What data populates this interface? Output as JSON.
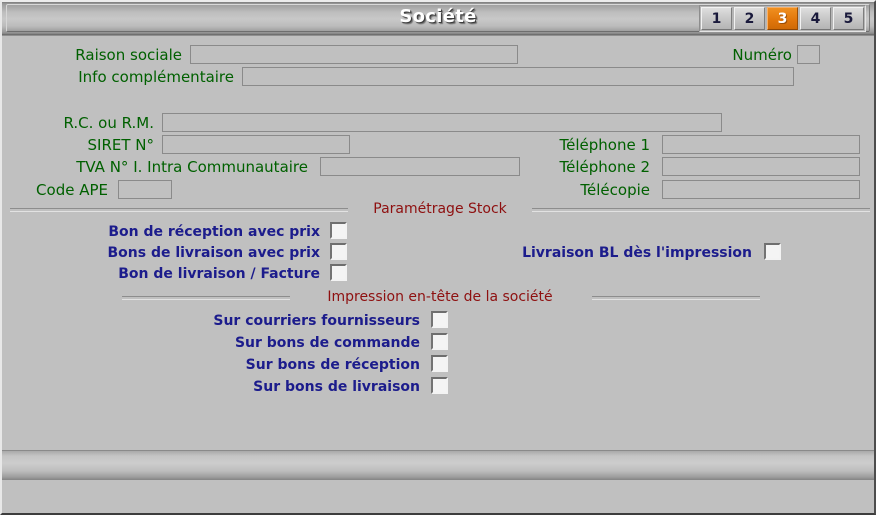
{
  "window": {
    "title": "Société",
    "status_text": ""
  },
  "tabs": [
    {
      "label": "1",
      "active": false
    },
    {
      "label": "2",
      "active": false
    },
    {
      "label": "3",
      "active": true
    },
    {
      "label": "4",
      "active": false
    },
    {
      "label": "5",
      "active": false
    }
  ],
  "identity": {
    "raison_sociale_label": "Raison sociale",
    "raison_sociale_value": "",
    "info_complementaire_label": "Info complémentaire",
    "info_complementaire_value": "",
    "numero_label": "Numéro",
    "numero_value": ""
  },
  "legal": {
    "rc_rm_label": "R.C. ou R.M.",
    "rc_rm_value": "",
    "siret_label": "SIRET N°",
    "siret_value": "",
    "tva_label": "TVA N° I. Intra Communautaire",
    "tva_value": "",
    "code_ape_label": "Code APE",
    "code_ape_value": ""
  },
  "contact": {
    "tel1_label": "Téléphone 1",
    "tel1_value": "",
    "tel2_label": "Téléphone 2",
    "tel2_value": "",
    "fax_label": "Télécopie",
    "fax_value": ""
  },
  "stock_section": {
    "title": "Paramétrage Stock",
    "options": [
      {
        "label": "Bon de réception avec prix",
        "checked": false
      },
      {
        "label": "Bons de livraison avec prix",
        "checked": false
      },
      {
        "label": "Bon de livraison / Facture",
        "checked": false
      }
    ],
    "right_option": {
      "label": "Livraison BL dès l'impression",
      "checked": false
    }
  },
  "header_section": {
    "title": "Impression en-tête de la société",
    "options": [
      {
        "label": "Sur courriers fournisseurs",
        "checked": false
      },
      {
        "label": "Sur bons de commande",
        "checked": false
      },
      {
        "label": "Sur bons de réception",
        "checked": false
      },
      {
        "label": "Sur bons de livraison",
        "checked": false
      }
    ]
  },
  "colors": {
    "form_background": "#c0c0c0",
    "label_green": "#006000",
    "section_red": "#8e1010",
    "checkbox_label_blue": "#1c1c8c",
    "tab_active": "#e2770c",
    "title_text": "#ffffff"
  }
}
